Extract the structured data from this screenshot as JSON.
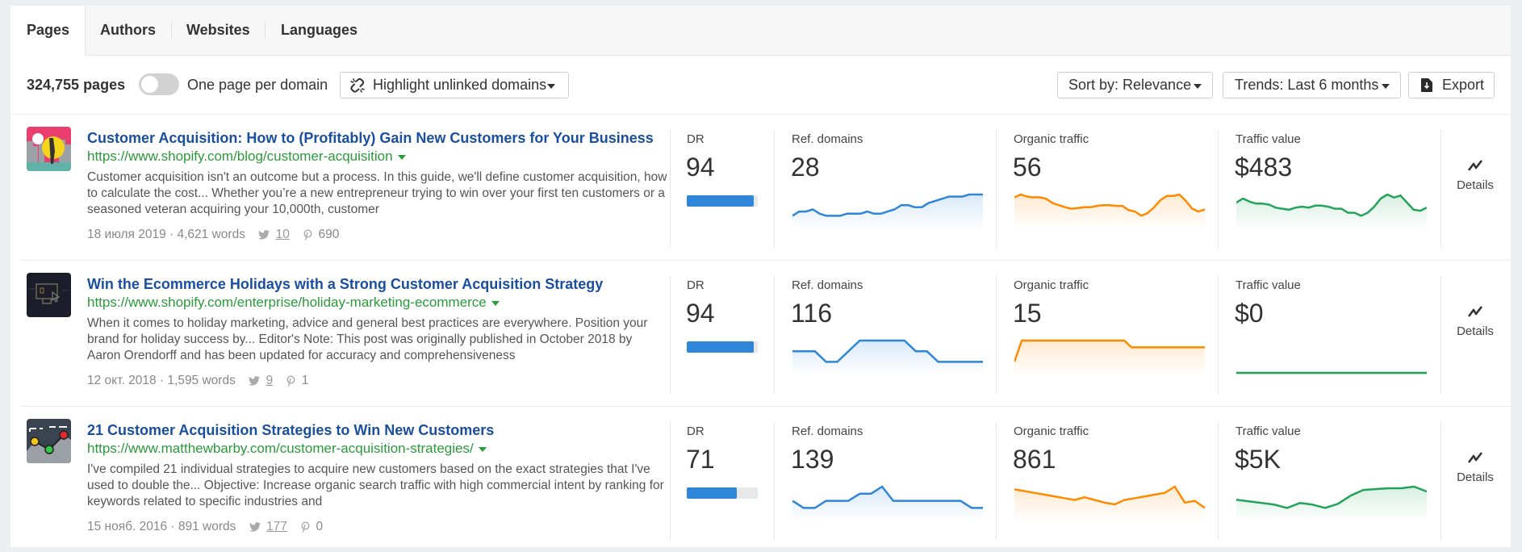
{
  "tabs": [
    {
      "label": "Pages",
      "active": true
    },
    {
      "label": "Authors",
      "active": false
    },
    {
      "label": "Websites",
      "active": false
    },
    {
      "label": "Languages",
      "active": false
    }
  ],
  "toolbar": {
    "count_label": "324,755 pages",
    "toggle_label": "One page per domain",
    "toggle_on": false,
    "highlight_label": "Highlight unlinked domains",
    "sort_label": "Sort by: Relevance",
    "trends_label": "Trends: Last 6 months",
    "export_label": "Export"
  },
  "metric_labels": {
    "dr": "DR",
    "ref_domains": "Ref. domains",
    "organic_traffic": "Organic traffic",
    "traffic_value": "Traffic value",
    "details": "Details"
  },
  "colors": {
    "link": "#1a4fa0",
    "url": "#2a9a3a",
    "ref_domains": "#2f85d8",
    "organic_traffic": "#ff8a00",
    "traffic_value": "#23a35a",
    "dr_bar": "#2f85d8"
  },
  "results": [
    {
      "title": "Customer Acquisition: How to (Profitably) Gain New Customers for Your Business",
      "url": "https://www.shopify.com/blog/customer-acquisition",
      "description": "Customer acquisition isn't an outcome but a process. In this guide, we'll define customer acquisition, how to calculate the cost... Whether you’re a new entrepreneur trying to win over your first ten customers or a seasoned veteran acquiring your 10,000th, customer",
      "date": "18 июля 2019",
      "words": "4,621 words",
      "twitter": "10",
      "pinterest": "690",
      "thumbnail": "city-illustration-thumbnail",
      "dr": "94",
      "dr_value": 94,
      "ref_domains": "28",
      "organic_traffic": "56",
      "traffic_value": "$483",
      "trend_ref_domains": [
        20,
        22,
        22,
        23,
        21,
        20,
        20,
        20,
        21,
        21,
        21,
        22,
        21,
        21,
        22,
        23,
        25,
        25,
        24,
        24,
        26,
        27,
        28,
        29,
        29,
        29,
        30,
        30,
        30
      ],
      "trend_organic_traffic": [
        60,
        64,
        61,
        60,
        60,
        58,
        52,
        49,
        46,
        44,
        45,
        46,
        46,
        48,
        49,
        49,
        48,
        48,
        42,
        40,
        34,
        38,
        46,
        56,
        62,
        62,
        64,
        55,
        44,
        40,
        43
      ],
      "trend_traffic_value": [
        480,
        520,
        490,
        470,
        470,
        460,
        430,
        420,
        410,
        430,
        440,
        430,
        450,
        450,
        440,
        420,
        420,
        380,
        380,
        350,
        380,
        440,
        520,
        560,
        530,
        550,
        480,
        410,
        400,
        430
      ]
    },
    {
      "title": "Win the Ecommerce Holidays with a Strong Customer Acquisition Strategy",
      "url": "https://www.shopify.com/enterprise/holiday-marketing-ecommerce",
      "description": "When it comes to holiday marketing, advice and general best practices are everywhere. Position your brand for holiday success by... Editor's Note: This post was originally published in October 2018 by Aaron Orendorff and has been updated for accuracy and comprehensiveness",
      "date": "12 окт. 2018",
      "words": "1,595 words",
      "twitter": "9",
      "pinterest": "1",
      "thumbnail": "monitor-illustration-thumbnail",
      "dr": "94",
      "dr_value": 94,
      "ref_domains": "116",
      "organic_traffic": "15",
      "traffic_value": "$0",
      "trend_ref_domains": [
        116,
        116,
        116,
        115,
        115,
        116,
        117,
        117,
        117,
        117,
        117,
        116,
        116,
        115,
        115,
        115,
        115,
        115
      ],
      "trend_organic_traffic": [
        0,
        22,
        22,
        22,
        22,
        22,
        22,
        22,
        22,
        22,
        22,
        22,
        22,
        22,
        22,
        22,
        15,
        15,
        15,
        15,
        15,
        15,
        15,
        15,
        15,
        15,
        15
      ],
      "trend_traffic_value": [
        0,
        0,
        0,
        0,
        0,
        0,
        0,
        0,
        0,
        0,
        0,
        0,
        0,
        0,
        0,
        0,
        0,
        0
      ]
    },
    {
      "title": "21 Customer Acquisition Strategies to Win New Customers",
      "url": "https://www.matthewbarby.com/customer-acquisition-strategies/",
      "description": "I've compiled 21 individual strategies to acquire new customers based on the exact strategies that I've used to double the... Objective:  Increase organic search traffic with high commercial intent by ranking for keywords related to specific industries and",
      "date": "15 нояб. 2016",
      "words": "891 words",
      "twitter": "177",
      "pinterest": "0",
      "thumbnail": "chart-illustration-thumbnail",
      "dr": "71",
      "dr_value": 71,
      "ref_domains": "139",
      "organic_traffic": "861",
      "traffic_value": "$5K",
      "trend_ref_domains": [
        139,
        138,
        138,
        139,
        139,
        139,
        140,
        140,
        141,
        139,
        139,
        139,
        139,
        139,
        139,
        139,
        138,
        138
      ],
      "trend_organic_traffic": [
        870,
        868,
        866,
        864,
        862,
        860,
        858,
        861,
        858,
        855,
        853,
        858,
        860,
        862,
        864,
        866,
        873,
        855,
        857,
        849
      ],
      "trend_traffic_value": [
        4700,
        4680,
        4660,
        4640,
        4600,
        4660,
        4640,
        4600,
        4650,
        4750,
        4820,
        4830,
        4840,
        4840,
        4860,
        4800
      ]
    }
  ]
}
